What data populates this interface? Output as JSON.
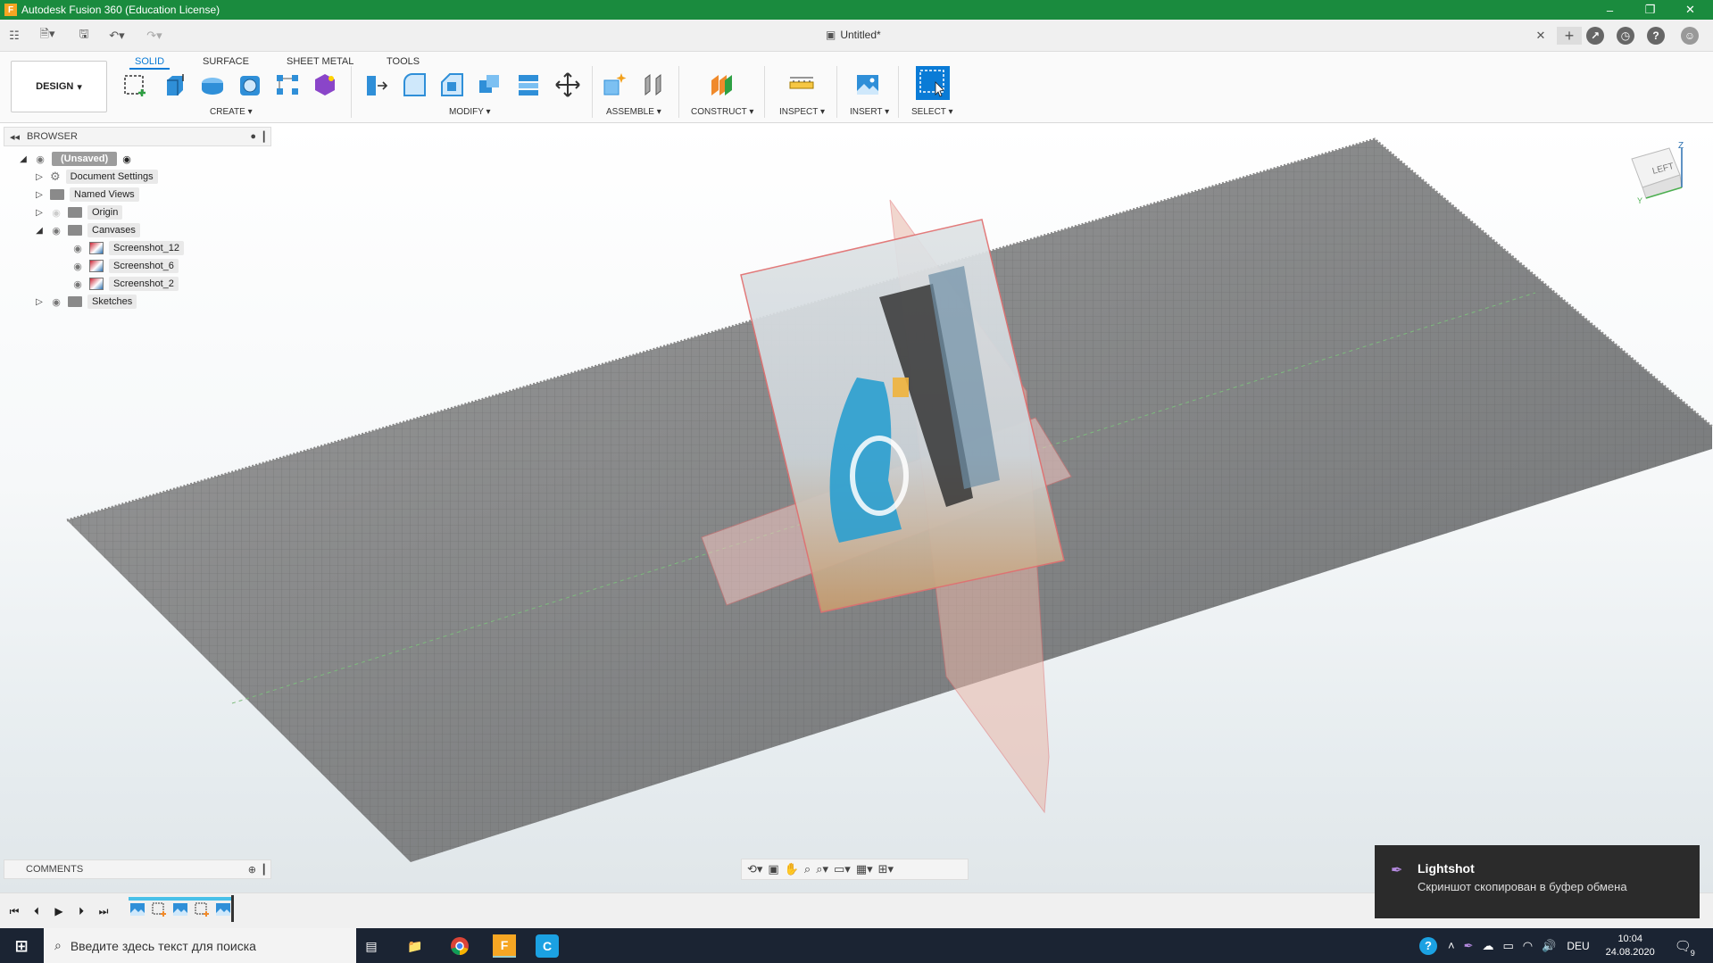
{
  "window": {
    "title": "Autodesk Fusion 360 (Education License)",
    "app_icon": "F"
  },
  "appbar": {
    "doc_title": "Untitled*"
  },
  "ribbon": {
    "tabs": [
      "SOLID",
      "SURFACE",
      "SHEET METAL",
      "TOOLS"
    ],
    "active_tab": "SOLID",
    "workspace": "DESIGN",
    "groups": [
      "CREATE",
      "MODIFY",
      "ASSEMBLE",
      "CONSTRUCT",
      "INSPECT",
      "INSERT",
      "SELECT"
    ]
  },
  "browser": {
    "title": "BROWSER",
    "root": "(Unsaved)",
    "items": [
      "Document Settings",
      "Named Views",
      "Origin",
      "Canvases",
      "Screenshot_12",
      "Screenshot_6",
      "Screenshot_2",
      "Sketches"
    ]
  },
  "viewcube": {
    "face": "LEFT",
    "axis_z": "Z",
    "axis_y": "Y"
  },
  "comments": {
    "title": "COMMENTS"
  },
  "toast": {
    "title": "Lightshot",
    "message": "Скриншот скопирован в буфер обмена"
  },
  "taskbar": {
    "search_placeholder": "Введите здесь текст для поиска",
    "lang": "DEU",
    "time": "10:04",
    "date": "24.08.2020",
    "notif_count": "9"
  },
  "colors": {
    "titlebar": "#1a8b3e",
    "accent": "#0a7bd6",
    "taskbar": "#1b2433"
  }
}
